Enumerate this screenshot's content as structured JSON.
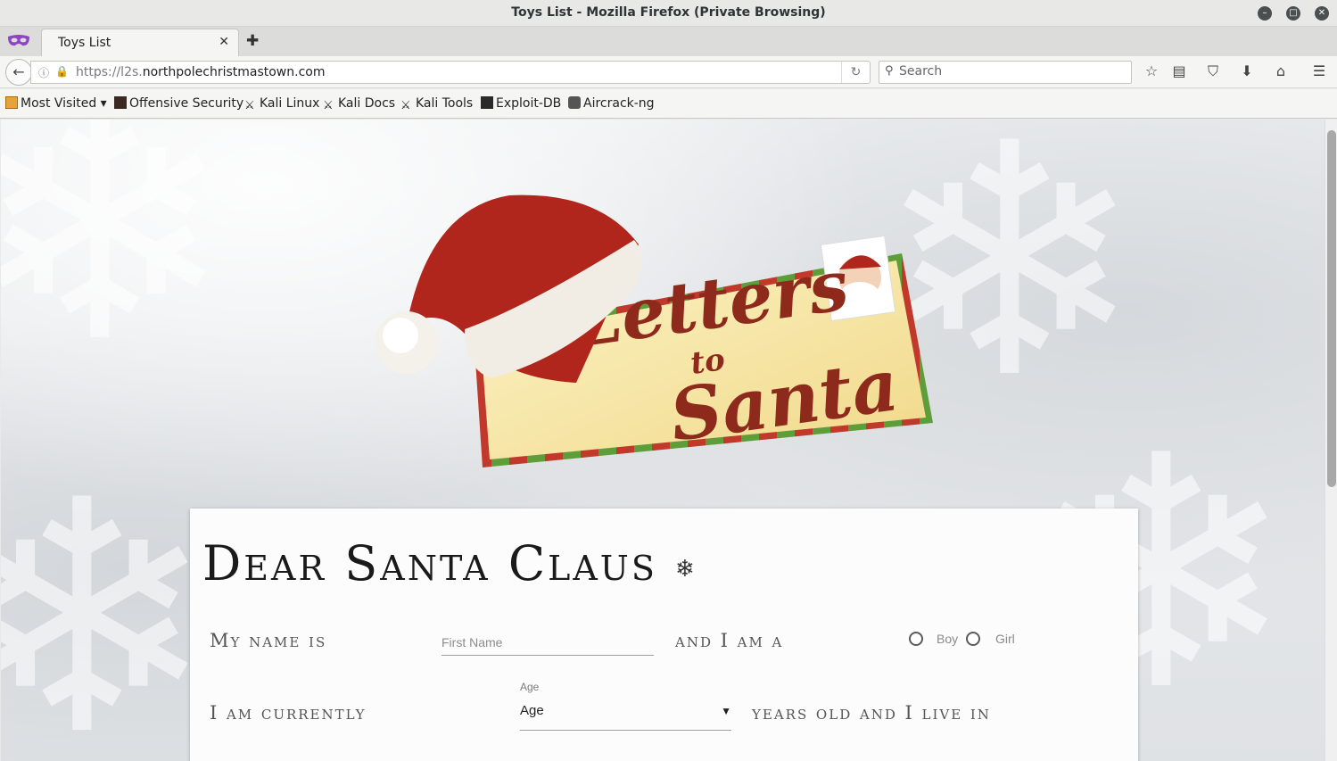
{
  "window": {
    "title": "Toys List - Mozilla Firefox (Private Browsing)"
  },
  "tabs": [
    {
      "label": "Toys List"
    }
  ],
  "navbar": {
    "url_prefix": "https://l2s.",
    "url_domain": "northpolechristmastown.com",
    "search_placeholder": "Search"
  },
  "bookmarks": [
    {
      "label": "Most Visited ▾",
      "icon": "most-visited-icon"
    },
    {
      "label": "Offensive Security",
      "icon": "offsec-icon"
    },
    {
      "label": "Kali Linux",
      "icon": "kali-dragon-icon"
    },
    {
      "label": "Kali Docs",
      "icon": "kali-dragon-icon"
    },
    {
      "label": "Kali Tools",
      "icon": "kali-dragon-icon"
    },
    {
      "label": "Exploit-DB",
      "icon": "exploit-db-icon"
    },
    {
      "label": "Aircrack-ng",
      "icon": "aircrack-icon"
    }
  ],
  "logo": {
    "line1": "Letters",
    "line2": "to",
    "line3": "Santa"
  },
  "form": {
    "heading": "Dear Santa Claus",
    "phrase_name": "My name is",
    "first_name_placeholder": "First Name",
    "phrase_gender": "and I am a",
    "gender_options": [
      "Boy",
      "Girl"
    ],
    "phrase_age": "I am currently",
    "age_label": "Age",
    "age_value": "Age",
    "phrase_live": "years old and I live in"
  },
  "colors": {
    "envelope": "#f7e9b0",
    "ink": "#8e2a1c",
    "hat_red": "#b0261c"
  }
}
